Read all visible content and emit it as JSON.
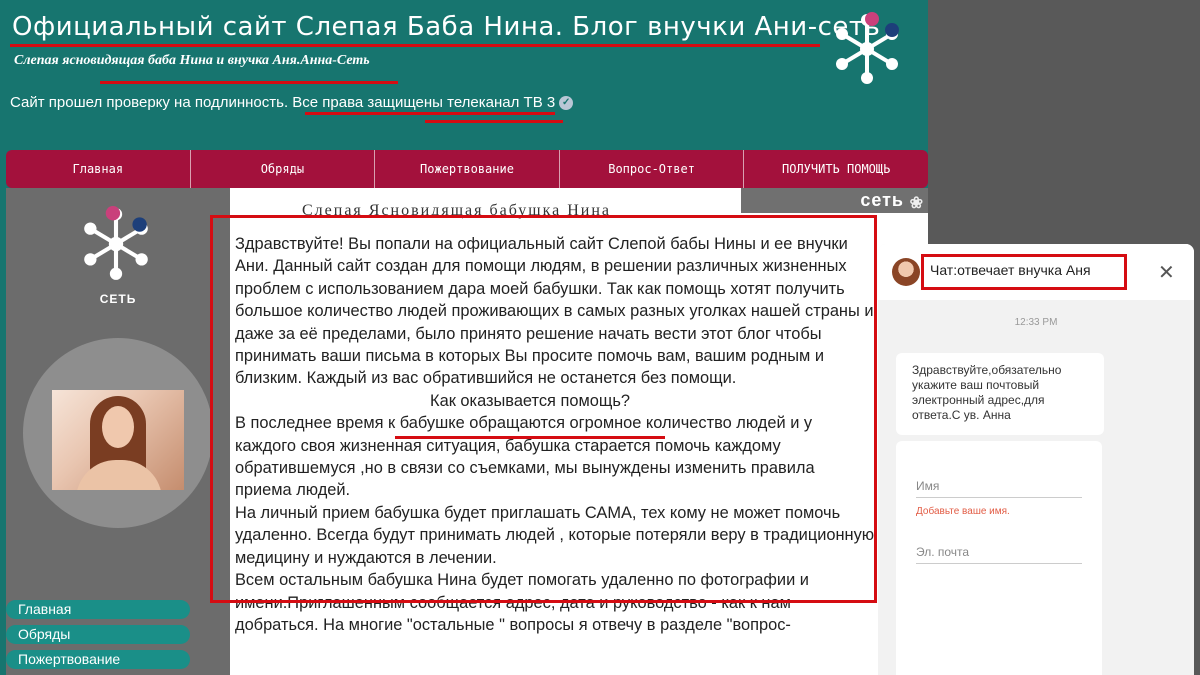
{
  "header": {
    "site_title": "Официальный сайт Слепая Баба Нина. Блог внучки Ани-сеть",
    "site_subtitle": "Слепая ясновидящая баба Нина и внучка Аня.Анна-Сеть",
    "verify_text": "Сайт прошел проверку на подлинность. Все права защищены телеканал ТВ 3",
    "verify_icon": "verified-check-icon"
  },
  "nav": {
    "items": [
      {
        "label": "Главная"
      },
      {
        "label": "Обряды"
      },
      {
        "label": "Пожертвование"
      },
      {
        "label": "Вопрос-Ответ"
      },
      {
        "label": "ПОЛУЧИТЬ ПОМОЩЬ"
      }
    ]
  },
  "sidebar": {
    "logo_label": "СЕТЬ",
    "menu": [
      {
        "label": "Главная"
      },
      {
        "label": "Обряды"
      },
      {
        "label": "Пожертвование"
      }
    ]
  },
  "content": {
    "heading": "Слепая Ясновидящая бабушка Нина",
    "banner": "сеть",
    "paragraphs": [
      "Здравствуйте! Вы попали на официальный сайт Слепой бабы Нины и ее внучки Ани. Данный сайт создан для помощи людям, в решении различных жизненных проблем с использованием дара моей бабушки. Так как помощь хотят получить большое количество людей проживающих в самых разных уголках нашей страны и даже за её пределами, было принято решение начать вести этот блог чтобы принимать ваши письма в которых Вы просите помочь вам, вашим родным и близким. Каждый из вас обратившийся не останется без помощи.",
      "Как оказывается помощь?",
      "В последнее время к бабушке обращаются огромное количество людей и у каждого своя жизненная ситуация, бабушка старается помочь каждому обратившемуся ,но в связи со съемками, мы вынуждены изменить правила приема людей.",
      "На личный прием бабушка будет приглашать САМА, тех кому не может помочь удаленно. Всегда  будут принимать людей , которые потеряли веру в традиционную медицину и нуждаются в лечении.",
      "Всем остальным бабушка Нина будет помогать удаленно по фотографии и имени.Приглашенным сообщается адрес, дата и руководство - как к нам добраться. На многие \"остальные \" вопросы я отвечу в разделе \"вопрос-"
    ]
  },
  "chat": {
    "title": "Чат:отвечает внучка Аня",
    "close_icon": "close-icon",
    "time": "12:33 PM",
    "message": "Здравствуйте,обязательно укажите ваш почтовый электронный адрес,для ответа.С ув. Анна",
    "form": {
      "name_placeholder": "Имя",
      "name_error": "Добавьте ваше имя.",
      "email_placeholder": "Эл. почта"
    }
  },
  "colors": {
    "teal": "#17756f",
    "nav_red": "#a3113c",
    "annotation_red": "#d50c12",
    "sidebar_gray": "#6c6c6c"
  }
}
